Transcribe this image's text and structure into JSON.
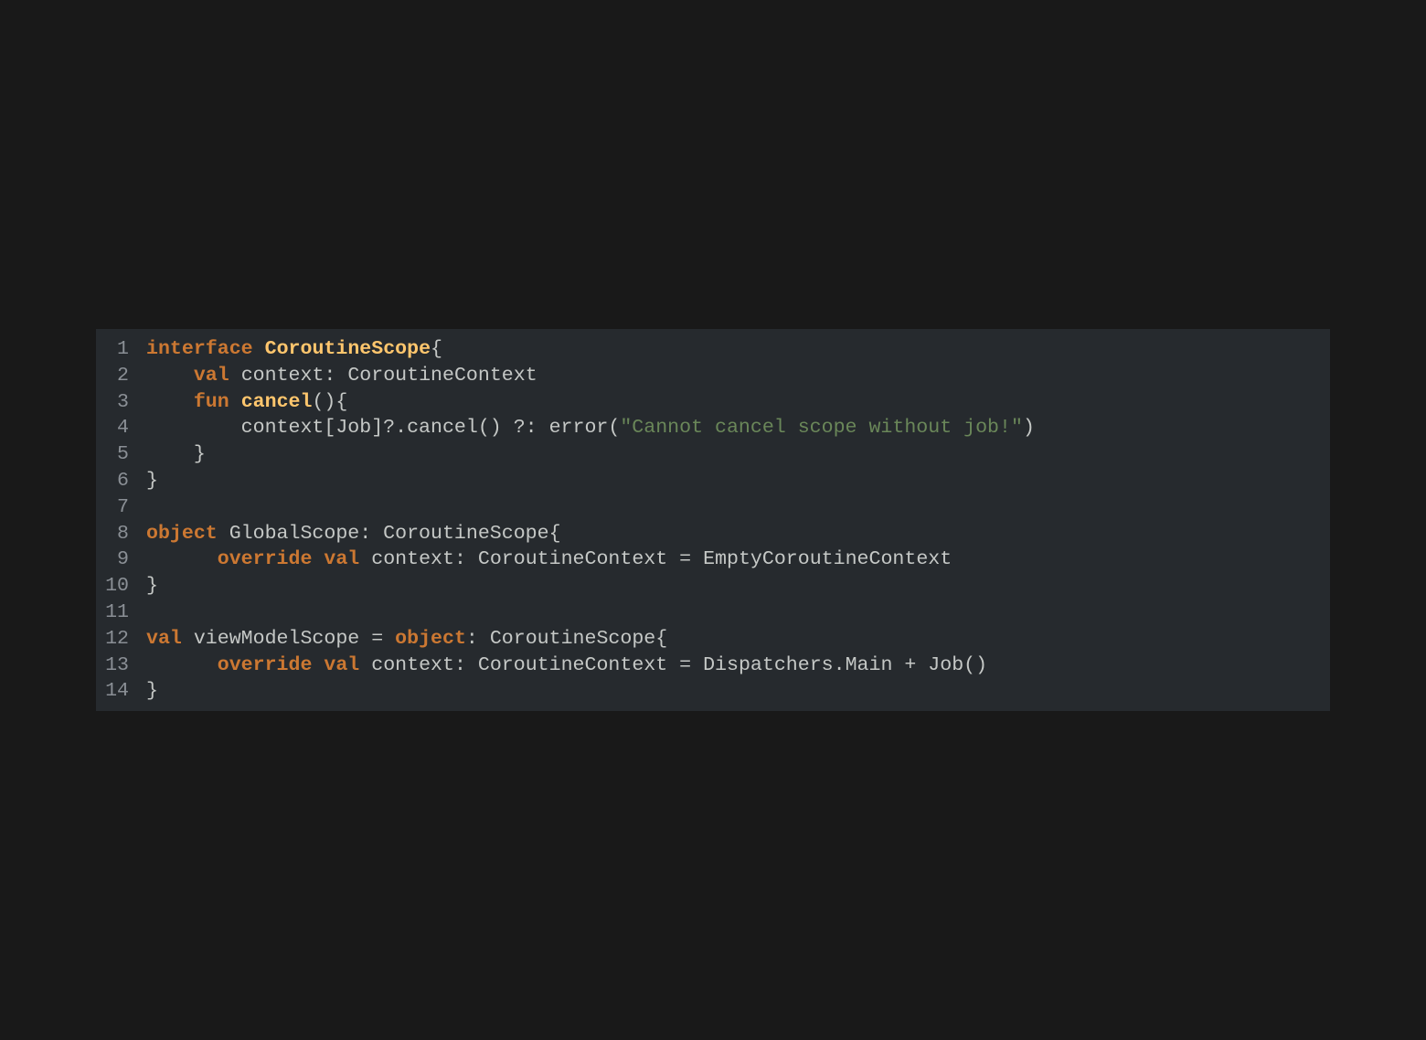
{
  "editor": {
    "language": "kotlin",
    "colors": {
      "background": "#191919",
      "panel": "#262a2e",
      "keyword": "#cc7832",
      "function": "#ffc66d",
      "string": "#6a8759",
      "text": "#c5c8c6",
      "line_number": "#8a8f95"
    },
    "lines": [
      {
        "number": "1",
        "tokens": [
          {
            "type": "kw",
            "text": "interface"
          },
          {
            "type": "plain",
            "text": " "
          },
          {
            "type": "fn",
            "text": "CoroutineScope"
          },
          {
            "type": "plain",
            "text": "{"
          }
        ]
      },
      {
        "number": "2",
        "tokens": [
          {
            "type": "plain",
            "text": "    "
          },
          {
            "type": "kw",
            "text": "val"
          },
          {
            "type": "plain",
            "text": " context: CoroutineContext"
          }
        ]
      },
      {
        "number": "3",
        "tokens": [
          {
            "type": "plain",
            "text": "    "
          },
          {
            "type": "kw",
            "text": "fun"
          },
          {
            "type": "plain",
            "text": " "
          },
          {
            "type": "fn",
            "text": "cancel"
          },
          {
            "type": "plain",
            "text": "(){"
          }
        ]
      },
      {
        "number": "4",
        "tokens": [
          {
            "type": "plain",
            "text": "        context[Job]?.cancel() ?: error("
          },
          {
            "type": "str",
            "text": "\"Cannot cancel scope without job!\""
          },
          {
            "type": "plain",
            "text": ")"
          }
        ]
      },
      {
        "number": "5",
        "tokens": [
          {
            "type": "plain",
            "text": "    }"
          }
        ]
      },
      {
        "number": "6",
        "tokens": [
          {
            "type": "plain",
            "text": "}"
          }
        ]
      },
      {
        "number": "7",
        "tokens": []
      },
      {
        "number": "8",
        "tokens": [
          {
            "type": "kw",
            "text": "object"
          },
          {
            "type": "plain",
            "text": " GlobalScope: CoroutineScope{"
          }
        ]
      },
      {
        "number": "9",
        "tokens": [
          {
            "type": "plain",
            "text": "      "
          },
          {
            "type": "kw",
            "text": "override val"
          },
          {
            "type": "plain",
            "text": " context: CoroutineContext = EmptyCoroutineContext"
          }
        ]
      },
      {
        "number": "10",
        "tokens": [
          {
            "type": "plain",
            "text": "}"
          }
        ]
      },
      {
        "number": "11",
        "tokens": []
      },
      {
        "number": "12",
        "tokens": [
          {
            "type": "kw",
            "text": "val"
          },
          {
            "type": "plain",
            "text": " viewModelScope = "
          },
          {
            "type": "kw",
            "text": "object"
          },
          {
            "type": "plain",
            "text": ": CoroutineScope{"
          }
        ]
      },
      {
        "number": "13",
        "tokens": [
          {
            "type": "plain",
            "text": "      "
          },
          {
            "type": "kw",
            "text": "override val"
          },
          {
            "type": "plain",
            "text": " context: CoroutineContext = Dispatchers.Main + Job()"
          }
        ]
      },
      {
        "number": "14",
        "tokens": [
          {
            "type": "plain",
            "text": "}"
          }
        ]
      }
    ]
  }
}
